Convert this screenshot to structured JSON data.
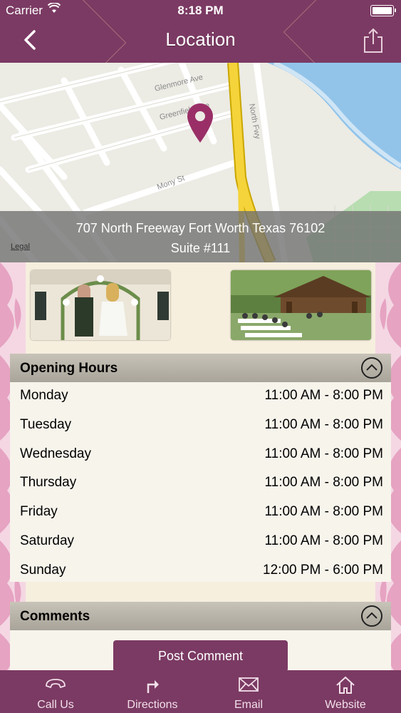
{
  "status_bar": {
    "carrier": "Carrier",
    "time": "8:18 PM"
  },
  "nav": {
    "title": "Location"
  },
  "map": {
    "streets": [
      "Glenmore Ave",
      "Greenfield Ave",
      "Mony St",
      "North Fwy"
    ],
    "address_line1": "707 North Freeway  Fort Worth Texas 76102",
    "address_line2": "Suite #111",
    "legal": "Legal"
  },
  "opening_hours": {
    "title": "Opening Hours",
    "rows": [
      {
        "day": "Monday",
        "time": "11:00 AM - 8:00 PM"
      },
      {
        "day": "Tuesday",
        "time": "11:00 AM - 8:00 PM"
      },
      {
        "day": "Wednesday",
        "time": "11:00 AM - 8:00 PM"
      },
      {
        "day": "Thursday",
        "time": "11:00 AM - 8:00 PM"
      },
      {
        "day": "Friday",
        "time": "11:00 AM - 8:00 PM"
      },
      {
        "day": "Saturday",
        "time": "11:00 AM - 8:00 PM"
      },
      {
        "day": "Sunday",
        "time": "12:00 PM - 6:00 PM"
      }
    ]
  },
  "comments": {
    "title": "Comments",
    "post_button": "Post Comment"
  },
  "tabs": [
    {
      "label": "Call Us",
      "icon": "phone-icon"
    },
    {
      "label": "Directions",
      "icon": "directions-arrow-icon"
    },
    {
      "label": "Email",
      "icon": "envelope-icon"
    },
    {
      "label": "Website",
      "icon": "home-icon"
    }
  ],
  "colors": {
    "brand": "#7b3a63",
    "accent_pink": "#e6a3c2",
    "map_pin": "#9a2f67",
    "highway": "#f5d33a"
  }
}
